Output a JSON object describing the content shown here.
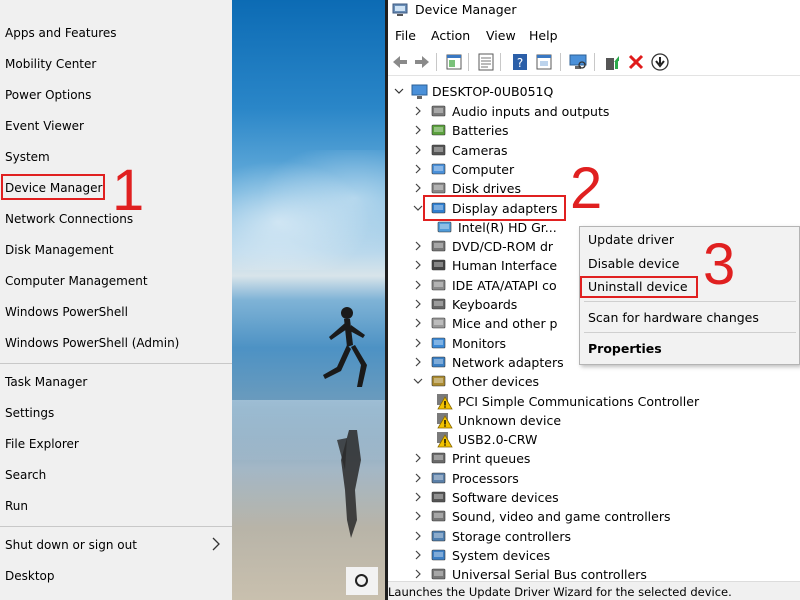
{
  "winx_menu": {
    "items": [
      {
        "label": "Apps and Features"
      },
      {
        "label": "Mobility Center"
      },
      {
        "label": "Power Options"
      },
      {
        "label": "Event Viewer"
      },
      {
        "label": "System"
      },
      {
        "label": "Device Manager"
      },
      {
        "label": "Network Connections"
      },
      {
        "label": "Disk Management"
      },
      {
        "label": "Computer Management"
      },
      {
        "label": "Windows PowerShell"
      },
      {
        "label": "Windows PowerShell (Admin)"
      },
      {
        "label": "Task Manager"
      },
      {
        "label": "Settings"
      },
      {
        "label": "File Explorer"
      },
      {
        "label": "Search"
      },
      {
        "label": "Run"
      },
      {
        "label": "Shut down or sign out"
      },
      {
        "label": "Desktop"
      }
    ]
  },
  "device_manager": {
    "title": "Device Manager",
    "menu": [
      "File",
      "Action",
      "View",
      "Help"
    ],
    "toolbar_icons": [
      "back-arrow-icon",
      "forward-arrow-icon",
      "properties-icon",
      "show-hidden-icon",
      "help-icon",
      "view-resources-icon",
      "scan-hardware-icon",
      "update-driver-icon",
      "uninstall-red-x-icon",
      "download-driver-icon"
    ],
    "root": "DESKTOP-0UB051Q",
    "tree": [
      {
        "label": "Audio inputs and outputs",
        "expanded": false
      },
      {
        "label": "Batteries",
        "expanded": false
      },
      {
        "label": "Cameras",
        "expanded": false
      },
      {
        "label": "Computer",
        "expanded": false
      },
      {
        "label": "Disk drives",
        "expanded": false
      },
      {
        "label": "Display adapters",
        "expanded": true
      },
      {
        "label": "Intel(R) HD Gr...",
        "child": true
      },
      {
        "label": "DVD/CD-ROM dr",
        "expanded": false
      },
      {
        "label": "Human Interface",
        "expanded": false
      },
      {
        "label": "IDE ATA/ATAPI co",
        "expanded": false
      },
      {
        "label": "Keyboards",
        "expanded": false
      },
      {
        "label": "Mice and other p",
        "expanded": false
      },
      {
        "label": "Monitors",
        "expanded": false
      },
      {
        "label": "Network adapters",
        "expanded": false
      },
      {
        "label": "Other devices",
        "expanded": true
      },
      {
        "label": "PCI Simple Communications Controller",
        "child": true
      },
      {
        "label": "Unknown device",
        "child": true
      },
      {
        "label": "USB2.0-CRW",
        "child": true
      },
      {
        "label": "Print queues",
        "expanded": false
      },
      {
        "label": "Processors",
        "expanded": false
      },
      {
        "label": "Software devices",
        "expanded": false
      },
      {
        "label": "Sound, video and game controllers",
        "expanded": false
      },
      {
        "label": "Storage controllers",
        "expanded": false
      },
      {
        "label": "System devices",
        "expanded": false
      },
      {
        "label": "Universal Serial Bus controllers",
        "expanded": false
      }
    ],
    "status": "Launches the Update Driver Wizard for the selected device."
  },
  "context_menu": {
    "items": [
      {
        "label": "Update driver"
      },
      {
        "label": "Disable device"
      },
      {
        "label": "Uninstall device"
      },
      {
        "label": "Scan for hardware changes"
      },
      {
        "label": "Properties"
      }
    ]
  },
  "annotations": {
    "step1": "1",
    "step2": "2",
    "step3": "3",
    "color": "#e02020"
  }
}
